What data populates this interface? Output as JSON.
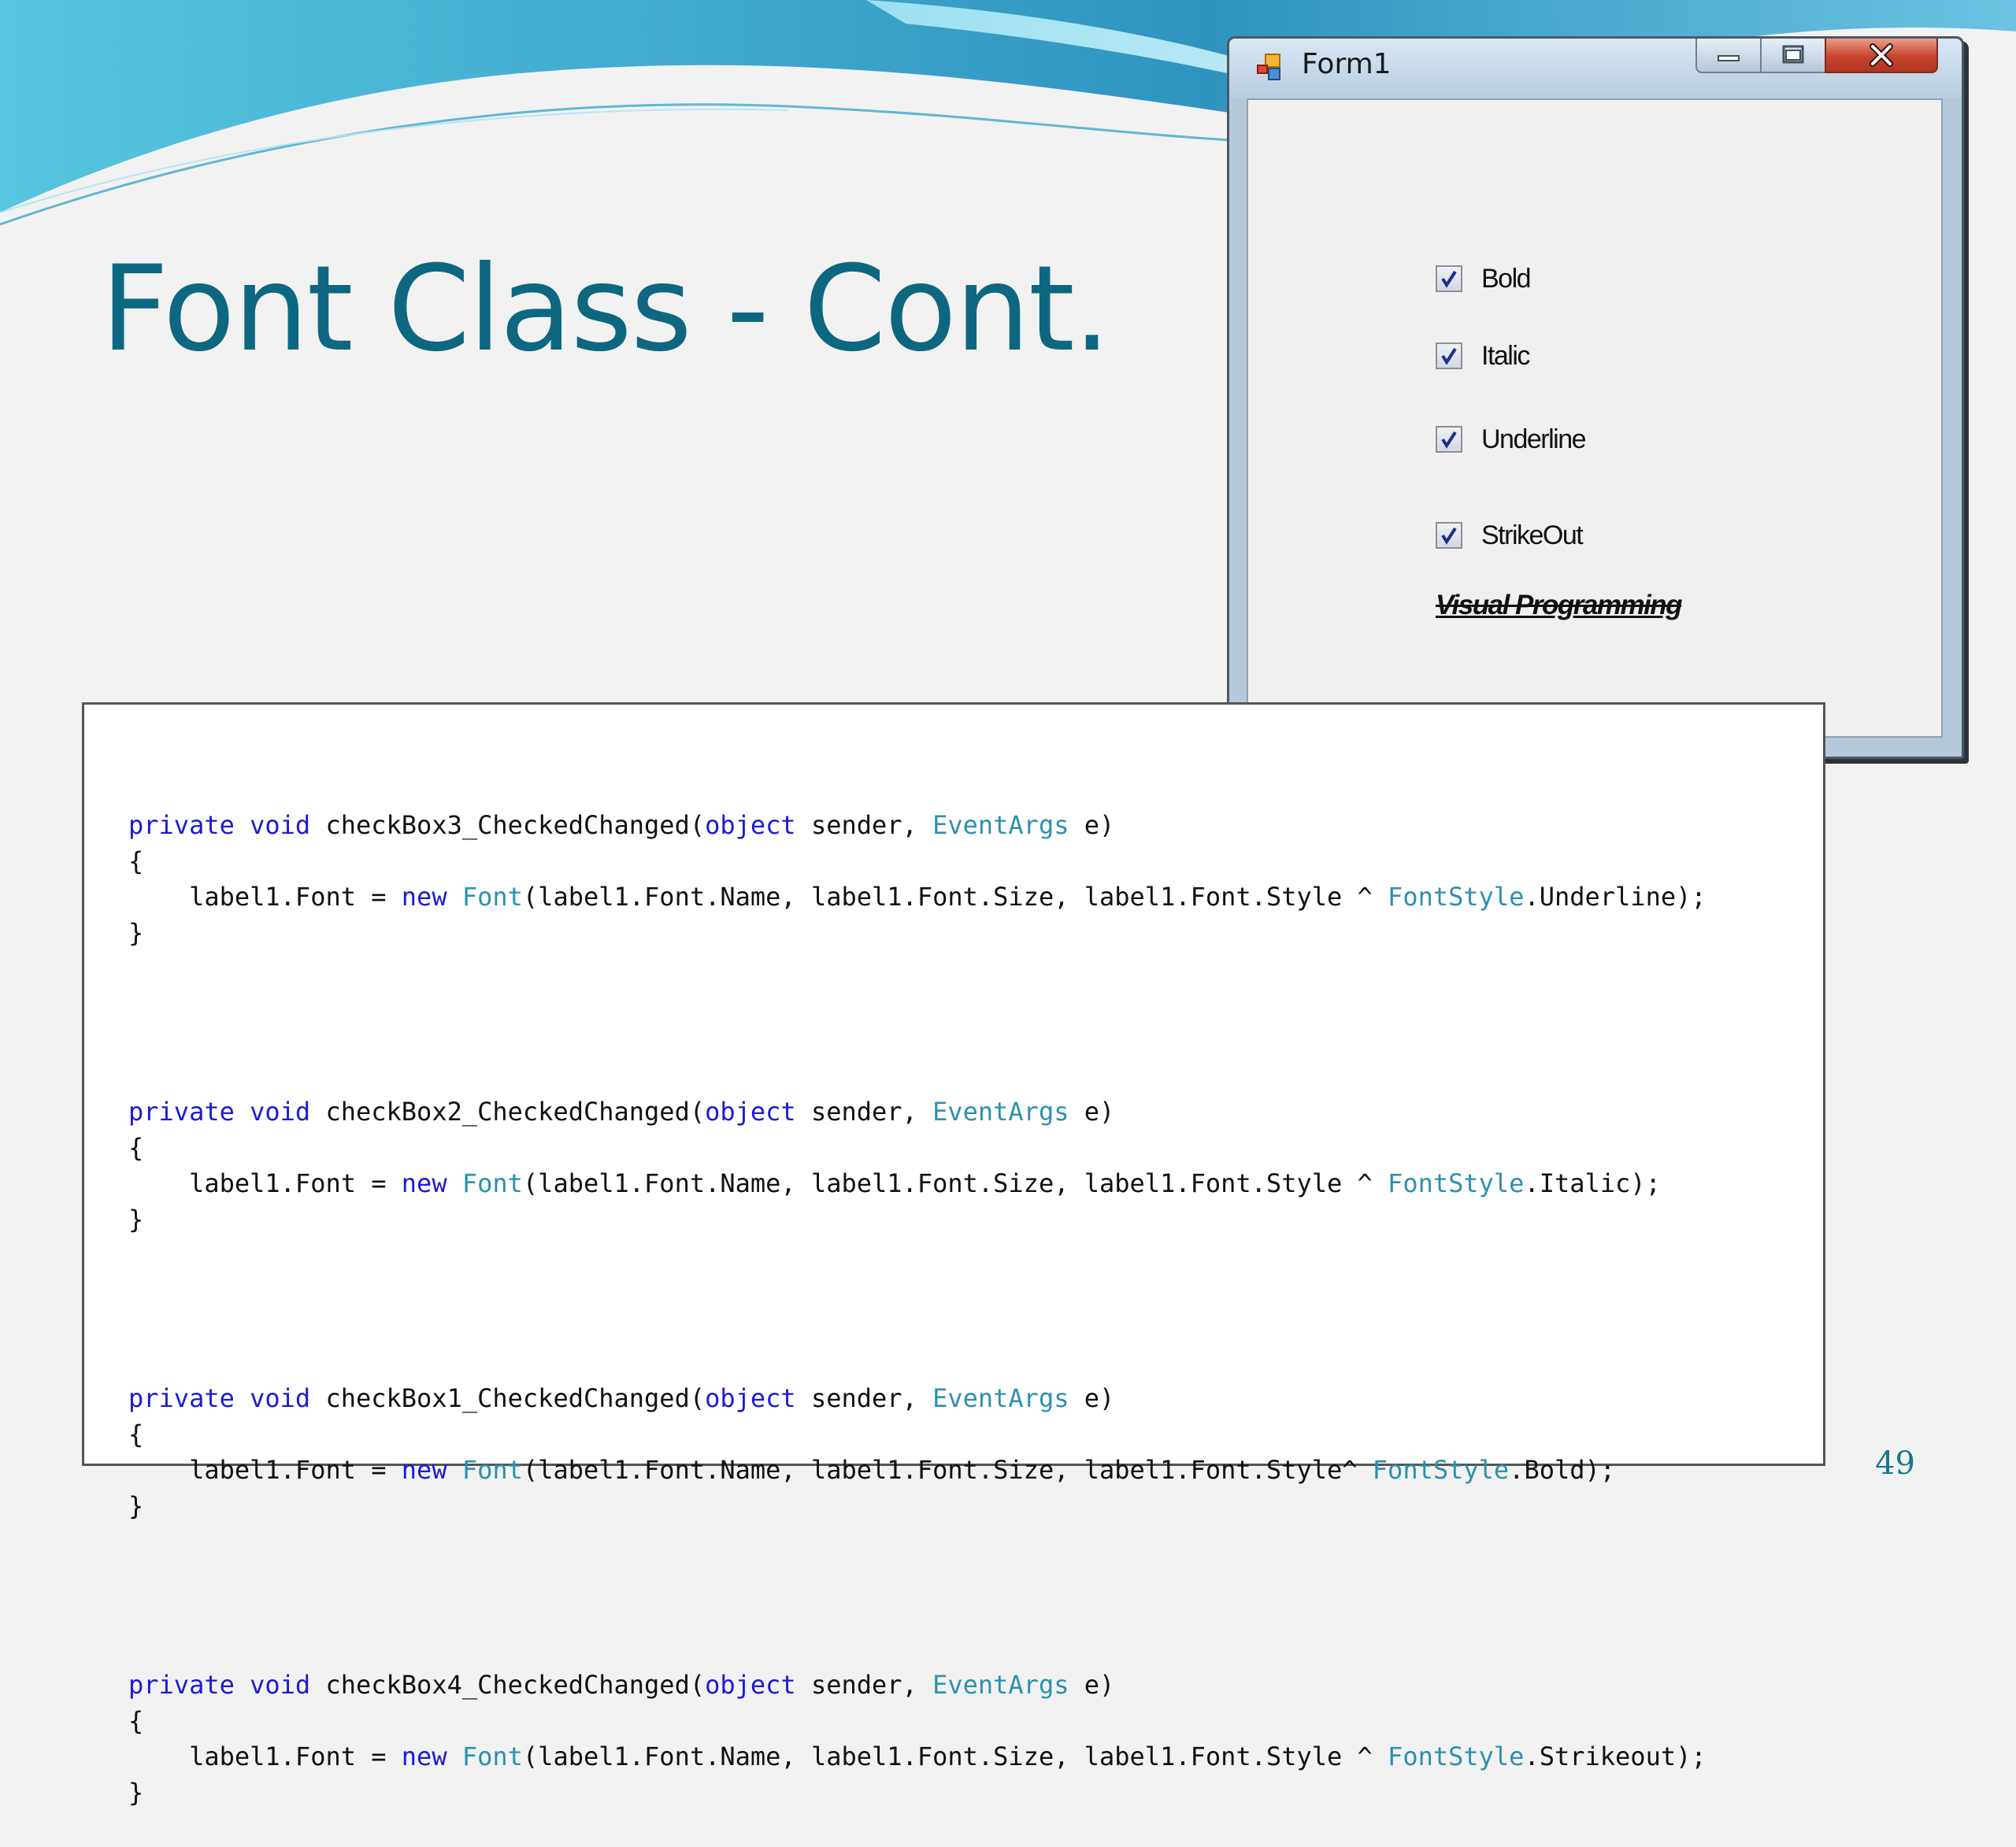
{
  "slide": {
    "title": "Font Class - Cont.",
    "page_number": "49",
    "colors": {
      "title": "#0e6781",
      "wave_dark": "#3a9fc6",
      "wave_light": "#8fd3ea"
    }
  },
  "form_window": {
    "title": "Form1",
    "icons": {
      "app": "winforms-app-icon",
      "minimize": "minimize-icon",
      "maximize": "maximize-icon",
      "close": "close-icon"
    },
    "checkboxes": [
      {
        "label": "Bold",
        "checked": true
      },
      {
        "label": "Italic",
        "checked": true
      },
      {
        "label": "Underline",
        "checked": true
      },
      {
        "label": "StrikeOut",
        "checked": true
      }
    ],
    "sample_label": "Visual Programming"
  },
  "code": {
    "colors": {
      "keyword": "#1b1bd6",
      "type": "#2b91af",
      "text": "#111111"
    },
    "methods": [
      {
        "name": "checkBox3_CheckedChanged",
        "ws": " ",
        "style": "Underline"
      },
      {
        "name": "checkBox2_CheckedChanged",
        "ws": " ",
        "style": "Italic"
      },
      {
        "name": "checkBox1_CheckedChanged",
        "ws": "",
        "style": "Bold"
      },
      {
        "name": "checkBox4_CheckedChanged",
        "ws": " ",
        "style": "Strikeout"
      }
    ],
    "tokens": {
      "private": "private",
      "void": "void",
      "object": "object",
      "sender": " sender, ",
      "eventargs": "EventArgs",
      "e_close": " e)",
      "brace_open": "{",
      "brace_close": "}",
      "assign": "    label1.Font = ",
      "new": "new",
      "font": "Font",
      "args": "(label1.Font.Name, label1.Font.Size, label1.Font.Style",
      "xor": "^ ",
      "fontstyle": "FontStyle",
      "end": ");"
    }
  }
}
